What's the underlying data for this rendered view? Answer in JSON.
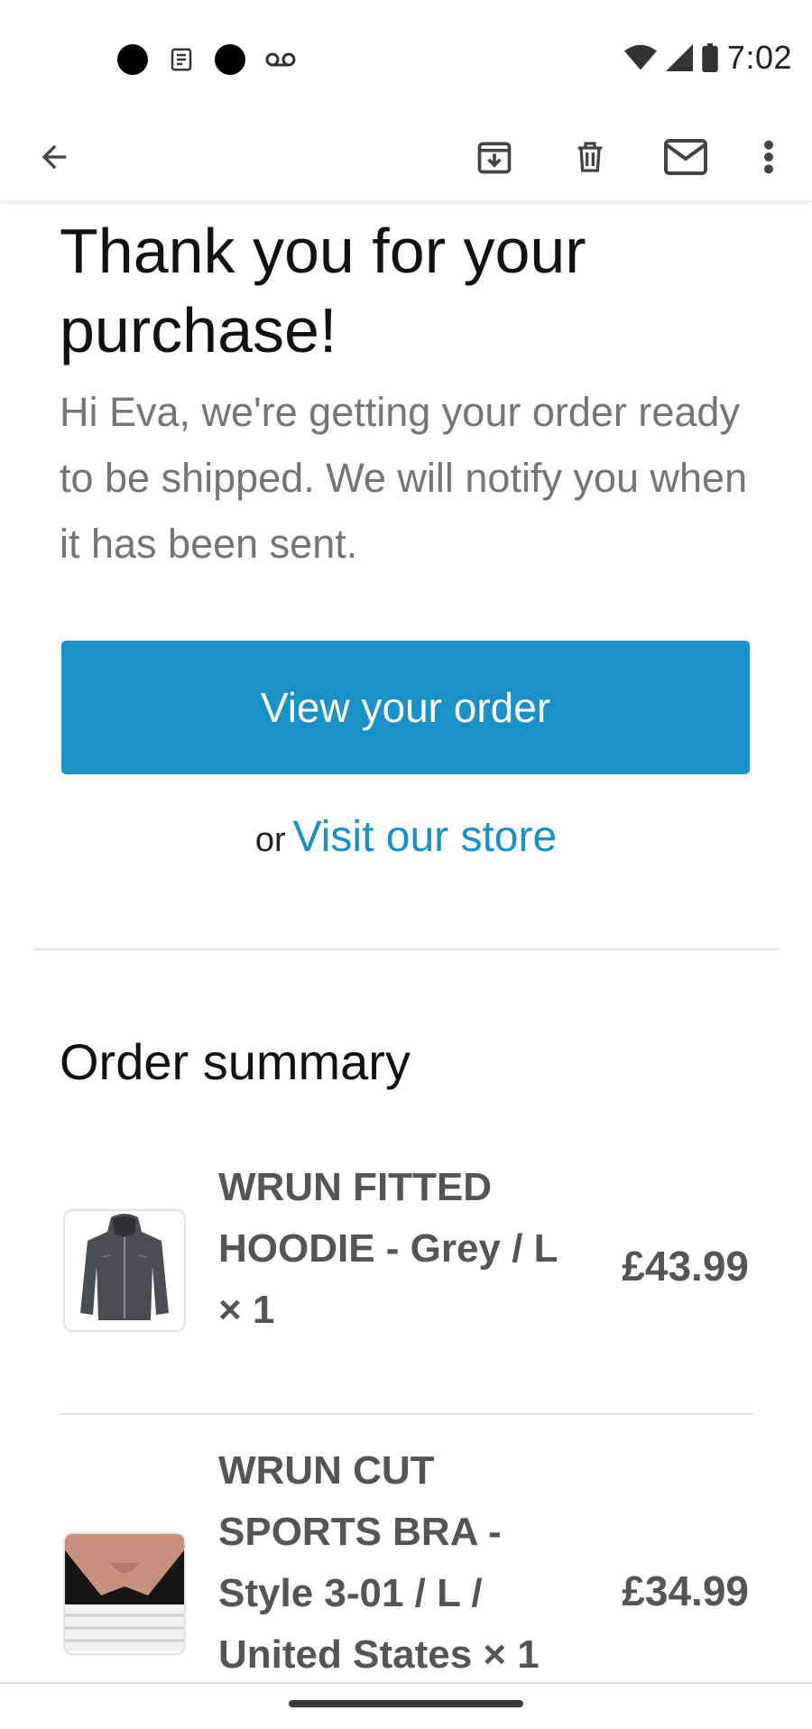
{
  "status_bar": {
    "time": "7:02",
    "left_icons": [
      "notification-dot-icon",
      "news-icon",
      "notification-dot-icon",
      "voicemail-icon"
    ],
    "right_icons": [
      "wifi-icon",
      "signal-icon",
      "battery-icon"
    ]
  },
  "app_bar": {
    "icons": [
      "back-arrow-icon",
      "archive-icon",
      "delete-icon",
      "mail-icon",
      "more-vert-icon"
    ]
  },
  "email": {
    "title": "Thank you for your purchase!",
    "intro": "Hi Eva, we're getting your order ready to be shipped. We will notify you when it has been sent.",
    "cta_label": "View your order",
    "or_text": "or",
    "store_link": "Visit our store",
    "summary_title": "Order summary",
    "items": [
      {
        "name": "WRUN FITTED HOODIE - Grey / L × 1",
        "price": "£43.99",
        "thumb": "grey-hoodie-image"
      },
      {
        "name": "WRUN CUT SPORTS BRA - Style 3-01 / L / United States × 1",
        "price": "£34.99",
        "thumb": "black-sports-bra-image"
      }
    ]
  },
  "colors": {
    "accent": "#1990c6",
    "muted_text": "#757575",
    "item_text": "#555555"
  }
}
